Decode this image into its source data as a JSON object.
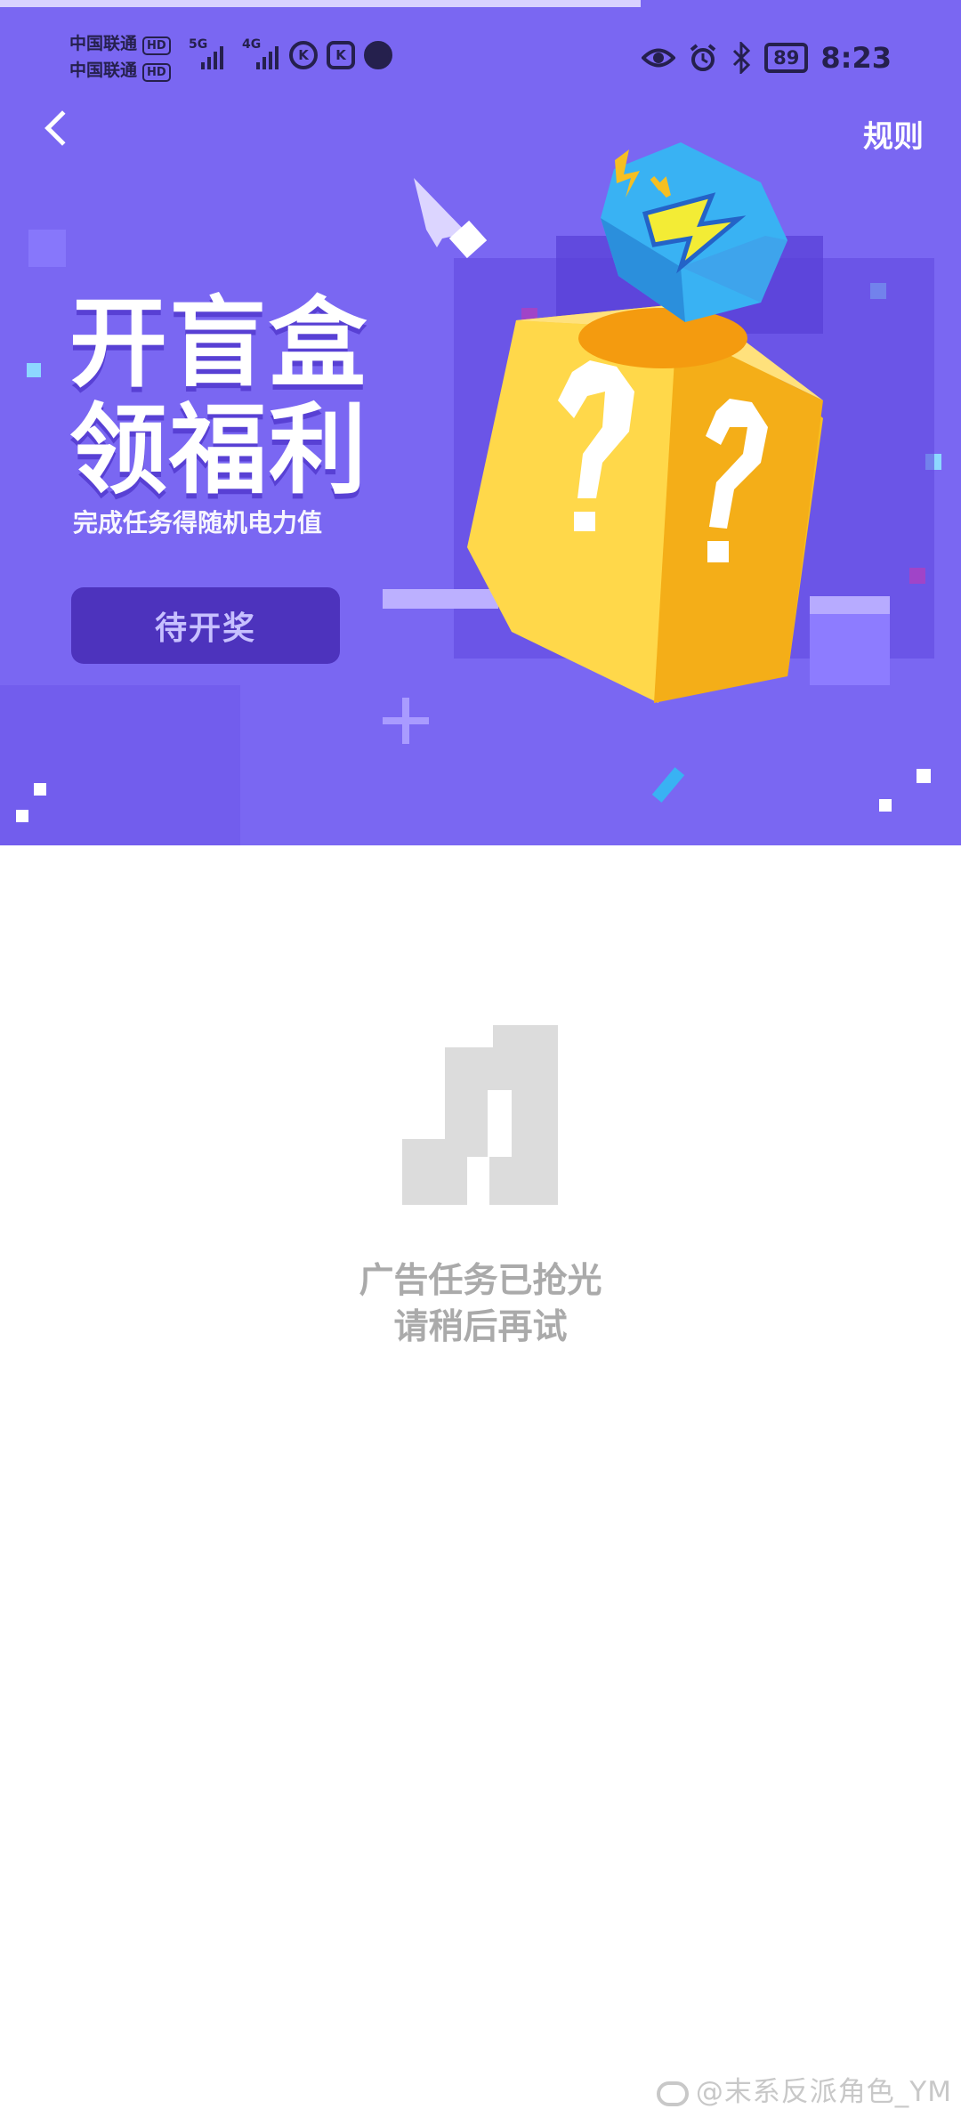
{
  "status": {
    "carrier1": "中国联通",
    "carrier2": "中国联通",
    "hd": "HD",
    "net1": "5G",
    "net2": "4G",
    "icon_k": "K",
    "battery": "89",
    "time": "8:23"
  },
  "header": {
    "back_icon": "chevron-left-icon",
    "rules": "规则"
  },
  "hero": {
    "title_line1": "开盲盒",
    "title_line2": "领福利",
    "subtitle": "完成任务得随机电力值",
    "draw_button": "待开奖"
  },
  "empty": {
    "icon": "empty-music-icon",
    "line1": "广告任务已抢光",
    "line2": "请稍后再试"
  },
  "watermark": "@末系反派角色_YM",
  "colors": {
    "hero_bg": "#7a67f2",
    "button_bg": "#4d33bd",
    "button_text": "#c7c0ff",
    "box_yellow": "#f9c62d",
    "gem_blue": "#39b2f3",
    "muted_text": "#aaaaaa"
  }
}
